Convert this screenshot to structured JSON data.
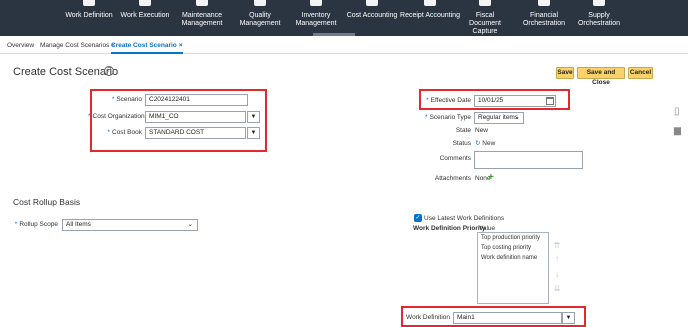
{
  "nav": [
    "Work Definition",
    "Work Execution",
    "Maintenance Management",
    "Quality Management",
    "Inventory Management",
    "Cost Accounting",
    "Receipt Accounting",
    "Fiscal Document Capture",
    "Financial Orchestration",
    "Supply Orchestration"
  ],
  "tabs": {
    "overview": "Overview",
    "manage": "Manage Cost Scenarios",
    "create": "Create Cost Scenario",
    "close": "×"
  },
  "header": {
    "title": "Create Cost Scenario",
    "help": "?",
    "save": "Save",
    "save_close": "Save and Close",
    "cancel": "Cancel"
  },
  "form": {
    "scenario_label": "Scenario",
    "scenario_value": "C2024122401",
    "cost_org_label": "Cost Organization",
    "cost_org_value": "MIM1_CO",
    "cost_book_label": "Cost Book",
    "cost_book_value": "STANDARD COST",
    "effective_date_label": "Effective Date",
    "effective_date_value": "10/01/25",
    "scenario_type_label": "Scenario Type",
    "scenario_type_value": "Regular items",
    "state_label": "State",
    "state_value": "New",
    "status_label": "Status",
    "status_value": "New",
    "comments_label": "Comments",
    "attachments_label": "Attachments",
    "attachments_value": "None"
  },
  "rollup": {
    "title": "Cost Rollup Basis",
    "scope_label": "Rollup Scope",
    "scope_value": "All Items",
    "latest_wd_label": "Use Latest Work Definitions",
    "latest_wd_checked": true,
    "priority_label": "Work Definition Priority",
    "priority_value_label": "Value",
    "priority_items": [
      "Top production priority",
      "Top costing priority",
      "Work definition name"
    ],
    "wd_label": "Work Definition",
    "wd_value": "Main1"
  },
  "colors": {
    "nav_bg": "#2b3542",
    "accent": "#0572ce",
    "button": "#fbd26a",
    "highlight": "#e1292f"
  }
}
